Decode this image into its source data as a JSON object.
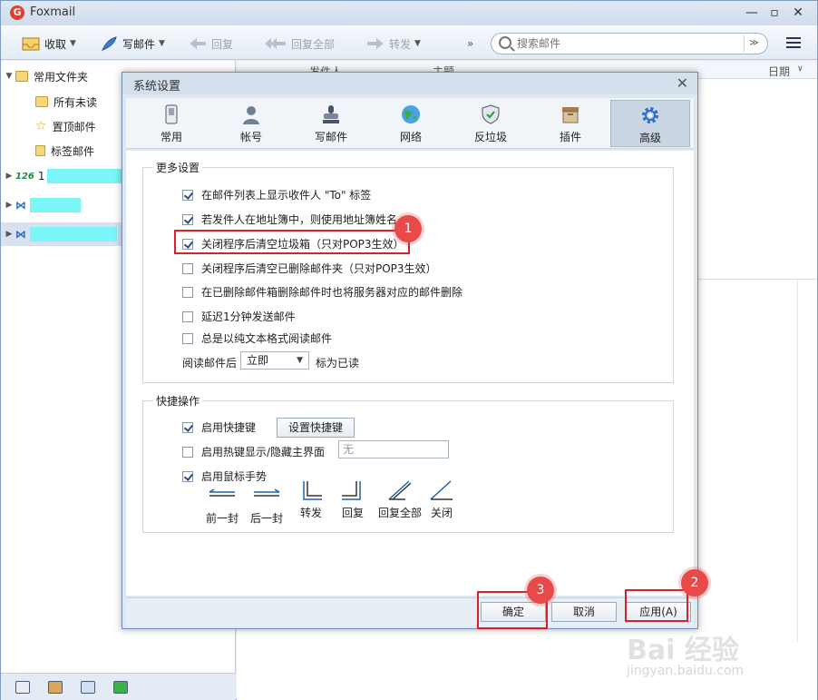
{
  "app": {
    "title": "Foxmail"
  },
  "toolbar": {
    "receive": "收取",
    "compose": "写邮件",
    "reply": "回复",
    "reply_all": "回复全部",
    "forward": "转发",
    "more": "»",
    "search_placeholder": "搜索邮件"
  },
  "sidebar": {
    "common_folders": "常用文件夹",
    "all_unread": "所有未读",
    "pinned": "置顶邮件",
    "tagged": "标签邮件",
    "account1_prefix": "126",
    "account1_char": "1"
  },
  "mail_list": {
    "col_sender": "发件人",
    "col_subject": "主题",
    "col_date": "日期"
  },
  "dialog": {
    "title": "系统设置",
    "tabs": [
      {
        "label": "常用",
        "icon": "phone-icon"
      },
      {
        "label": "帐号",
        "icon": "user-icon"
      },
      {
        "label": "写邮件",
        "icon": "stamp-icon"
      },
      {
        "label": "网络",
        "icon": "globe-icon"
      },
      {
        "label": "反垃圾",
        "icon": "shield-icon"
      },
      {
        "label": "插件",
        "icon": "box-icon"
      },
      {
        "label": "高级",
        "icon": "gear-icon"
      }
    ],
    "more_settings": {
      "label": "更多设置",
      "options": [
        {
          "text": "在邮件列表上显示收件人 \"To\" 标签",
          "checked": true
        },
        {
          "text": "若发件人在地址簿中，则使用地址簿姓名",
          "checked": true
        },
        {
          "text": "关闭程序后清空垃圾箱（只对POP3生效）",
          "checked": true
        },
        {
          "text": "关闭程序后清空已删除邮件夹（只对POP3生效）",
          "checked": false
        },
        {
          "text": "在已删除邮件箱删除邮件时也将服务器对应的邮件删除",
          "checked": false
        },
        {
          "text": "延迟1分钟发送邮件",
          "checked": false
        },
        {
          "text": "总是以纯文本格式阅读邮件",
          "checked": false
        }
      ],
      "read_prefix": "阅读邮件后",
      "read_value": "立即",
      "read_suffix": "标为已读"
    },
    "shortcuts": {
      "label": "快捷操作",
      "enable_shortcut": "启用快捷键",
      "enable_shortcut_checked": true,
      "set_shortcut_button": "设置快捷键",
      "hotkey_toggle": "启用热键显示/隐藏主界面",
      "hotkey_toggle_checked": false,
      "hotkey_value": "无",
      "mouse_gesture": "启用鼠标手势",
      "mouse_gesture_checked": true,
      "gestures": [
        "前一封",
        "后一封",
        "转发",
        "回复",
        "回复全部",
        "关闭"
      ]
    },
    "buttons": {
      "ok": "确定",
      "cancel": "取消",
      "apply": "应用(A)"
    }
  },
  "annotations": {
    "step1": "1",
    "step2": "2",
    "step3": "3"
  },
  "watermark": {
    "main": "Bai 经验",
    "sub": "jingyan.baidu.com"
  },
  "colors": {
    "highlight": "#d9212a",
    "badge": "#e84a4a",
    "accent": "#2a4f86"
  }
}
